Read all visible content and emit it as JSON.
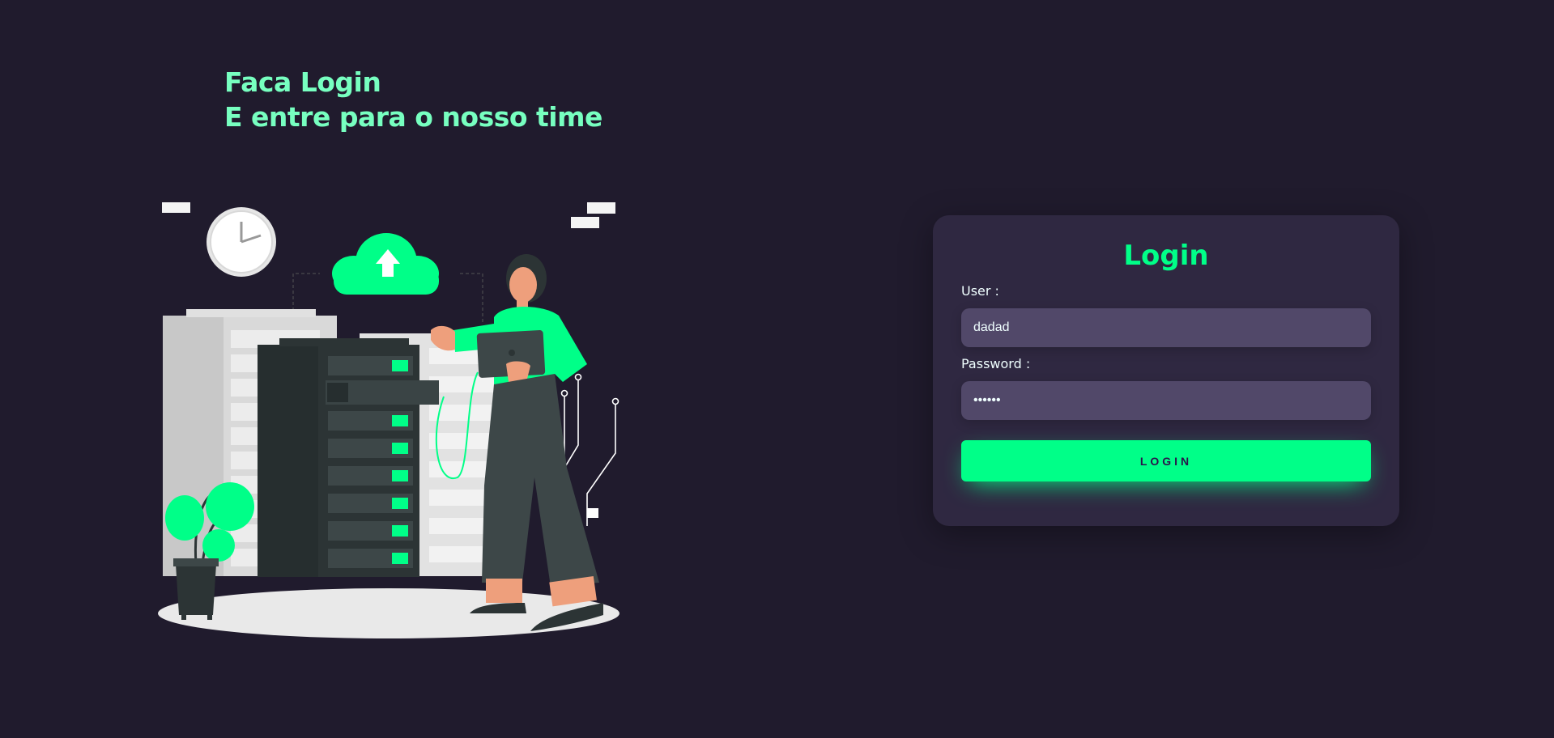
{
  "headline": {
    "line1": "Faca Login",
    "line2": "E entre para o nosso time"
  },
  "illustration": {
    "name": "server-room-illustration"
  },
  "login_card": {
    "title": "Login",
    "user_label": "User :",
    "user_value": "dadad",
    "password_label": "Password :",
    "password_value": "••••••",
    "button_label": "LOGIN"
  },
  "colors": {
    "background": "#201b2d",
    "card": "#2f2841",
    "accent": "#00ff88",
    "headline": "#77ffc0",
    "input": "#514869"
  }
}
